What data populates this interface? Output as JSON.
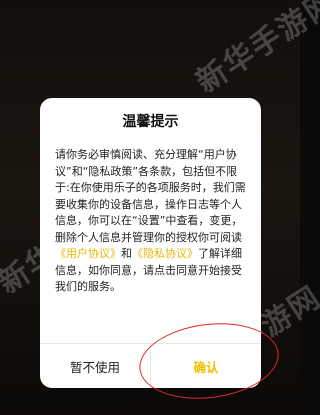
{
  "dialog": {
    "title": "温馨提示",
    "text_1": "请你务必审慎阅读、充分理解“用户协议”和“隐私政策”各条款，包括但不限于:在你使用乐子的各项服务时，我们需要收集你的设备信息，操作日志等个人信息，你可以在“设置”中查看，变更，删除个人信息并管理你的授权你可阅读",
    "link_user_agreement": "《用户协议》",
    "text_2": "和",
    "link_privacy_policy": "《隐私协议》",
    "text_3": "了解详细信息，如你同意，请点击同意开始接受我们的服务。",
    "cancel_label": "暂不使用",
    "confirm_label": "确认"
  },
  "watermark": {
    "text": "新华手游网"
  },
  "colors": {
    "accent": "#f0c000",
    "annotation": "#e02828",
    "background": "#0c0a08"
  }
}
